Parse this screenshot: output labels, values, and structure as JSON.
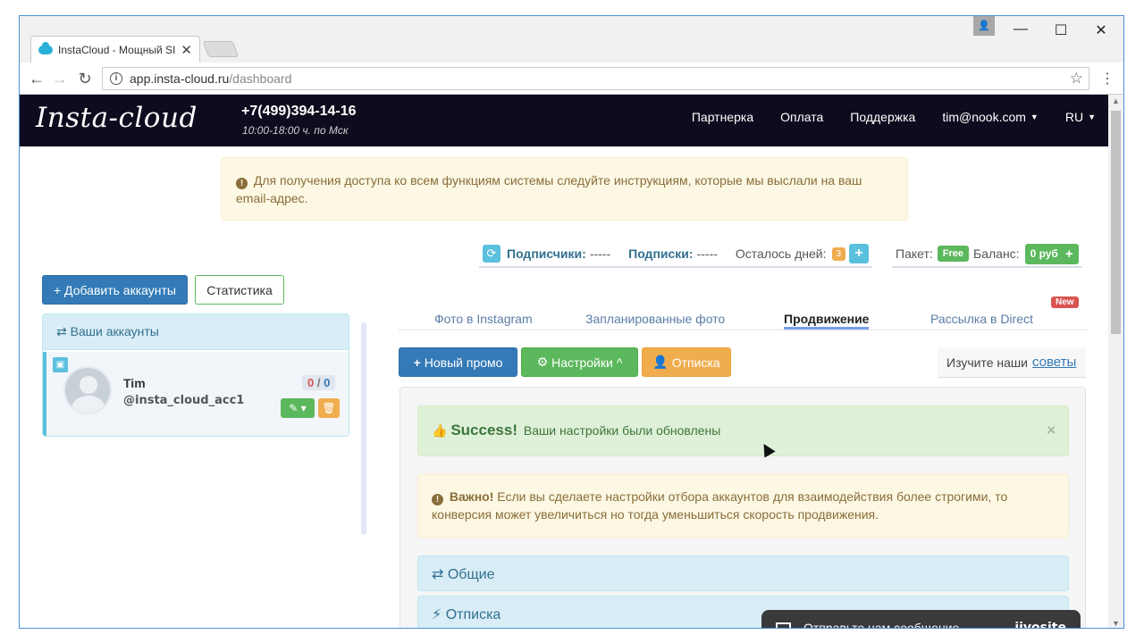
{
  "browser": {
    "tab_title": "InstaCloud - Мощный SI",
    "tab_close": "✕",
    "url_host": "app.insta-cloud.ru",
    "url_path": "/dashboard"
  },
  "header": {
    "logo": "Insta-cloud",
    "phone": "+7(499)394-14-16",
    "hours": "10:00-18:00 ч. по Мск",
    "nav": {
      "partner": "Партнерка",
      "payment": "Оплата",
      "support": "Поддержка",
      "user": "tim@nook.com",
      "lang": "RU"
    }
  },
  "notice": {
    "text": "Для получения доступа ко всем функциям системы следуйте инструкциям, которые мы выслали на ваш email-адрес."
  },
  "left": {
    "add_accounts": "+ Добавить аккаунты",
    "statistics": "Статистика",
    "accounts_header": "Ваши аккаунты",
    "account": {
      "name": "Tim",
      "handle": "@insta_cloud_acc1",
      "ratio_left": "0",
      "ratio_sep": "/",
      "ratio_right": "0"
    }
  },
  "stats": {
    "followers_label": "Подписчики:",
    "followers_value": "-----",
    "following_label": "Подписки:",
    "following_value": "-----",
    "days_label": "Осталось дней:",
    "days_value": "3",
    "package_label": "Пакет:",
    "package_value": "Free",
    "balance_label": "Баланс:",
    "balance_value": "0 руб"
  },
  "tabs": {
    "photos": "Фото в Instagram",
    "scheduled": "Запланированные фото",
    "promotion": "Продвижение",
    "direct": "Рассылка в Direct",
    "new_badge": "New"
  },
  "actions": {
    "new_promo": "Новый промо",
    "settings": "Настройки",
    "unfollow": "Отписка",
    "tips_text": "Изучите наши",
    "tips_link": "советы"
  },
  "alerts": {
    "success_title": "Success!",
    "success_text": "Ваши настройки были обновлены",
    "warn_title": "Важно!",
    "warn_text": "Если вы сделаете настройки отбора аккаунтов для взаимодействия более строгими, то конверсия может увеличиться но тогда уменьшиться скорость продвижения."
  },
  "panels": {
    "general": "Общие",
    "unfollow": "Отписка"
  },
  "chat": {
    "text": "Отправьте нам сообщение",
    "brand": "jivosite"
  }
}
